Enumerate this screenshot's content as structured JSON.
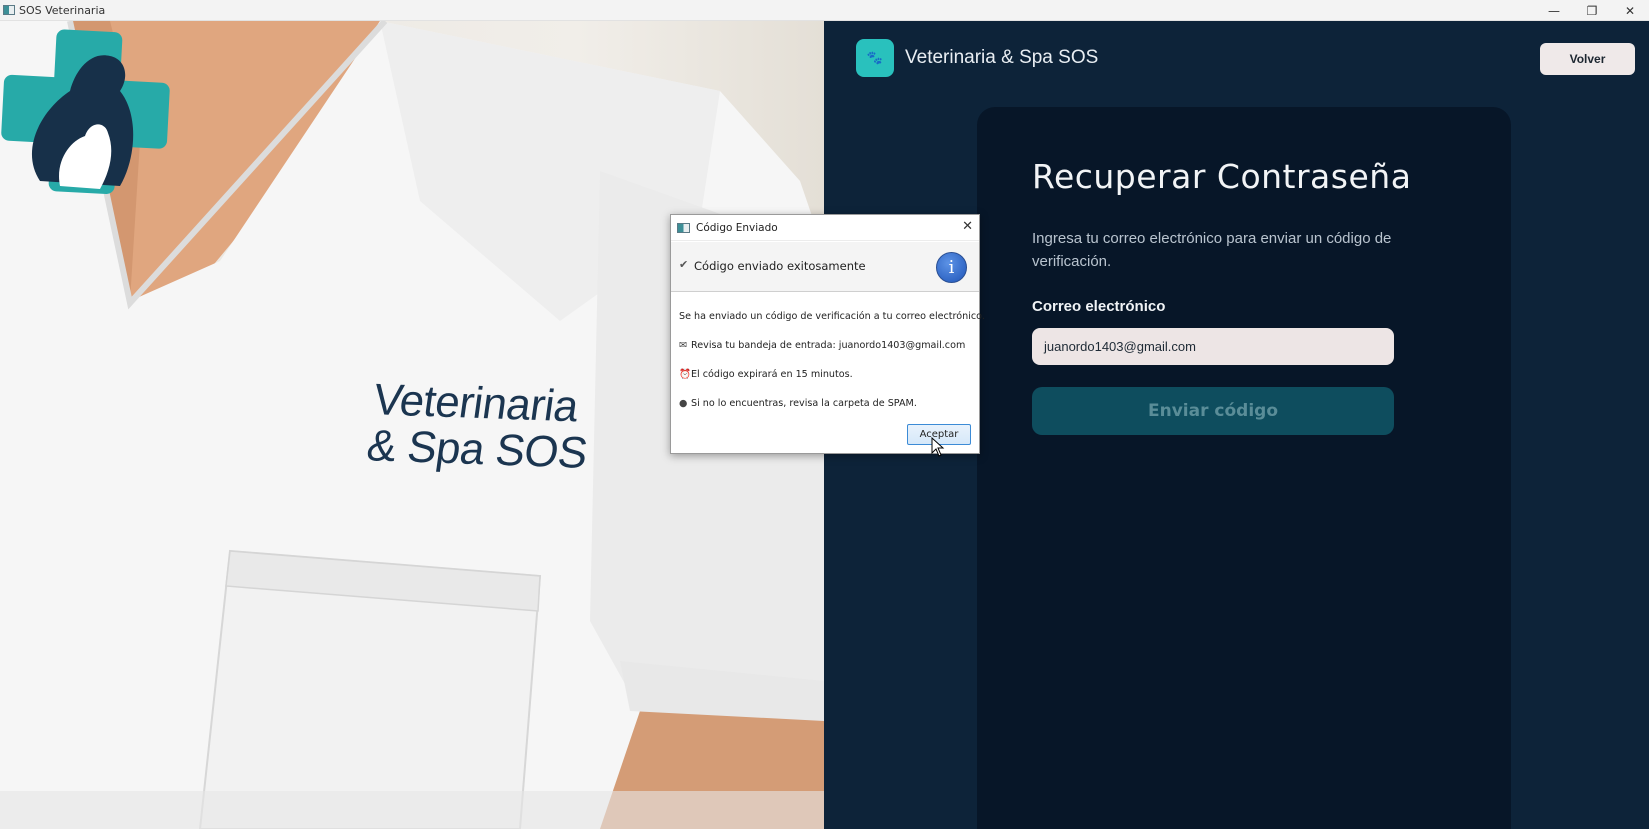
{
  "window": {
    "title": "SOS Veterinaria",
    "controls": {
      "minimize": "—",
      "restore": "❐",
      "close": "✕"
    }
  },
  "photo": {
    "brand_line1": "Veterinaria",
    "brand_line2": "& Spa SOS"
  },
  "header": {
    "brand_name": "Veterinaria & Spa SOS",
    "back_label": "Volver"
  },
  "card": {
    "title": "Recuperar Contraseña",
    "description": "Ingresa tu correo electrónico para enviar un código de verificación.",
    "email_label": "Correo electrónico",
    "email_value": "juanordo1403@gmail.com",
    "send_label": "Enviar código"
  },
  "dialog": {
    "title": "Código Enviado",
    "header_message": "Código enviado exitosamente",
    "info_glyph": "i",
    "lines": [
      "Se ha enviado un código de verificación a tu correo electrónico.",
      "Revisa tu bandeja de entrada: juanordo1403@gmail.com",
      "El código expirará en 15 minutos.",
      "Si no lo encuentras, revisa la carpeta de SPAM."
    ],
    "ok_label": "Aceptar"
  },
  "colors": {
    "accent_teal": "#29c1bd",
    "panel_bg": "#0d2339",
    "card_bg": "#071628",
    "send_button_bg": "#0e4d5e"
  }
}
